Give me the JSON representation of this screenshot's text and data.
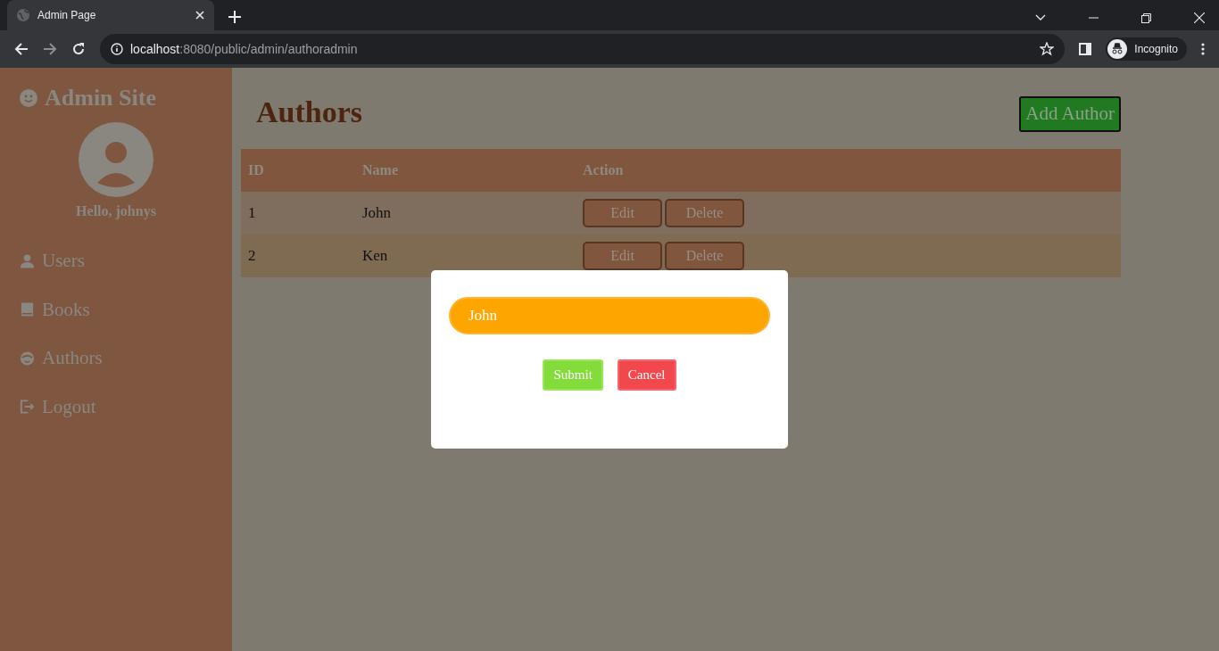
{
  "browser": {
    "tab_title": "Admin Page",
    "url_host": "localhost",
    "url_rest": ":8080/public/admin/authoradmin",
    "profile_label": "Incognito"
  },
  "sidebar": {
    "brand": "Admin Site",
    "greeting": "Hello, johnys",
    "items": [
      {
        "label": "Users"
      },
      {
        "label": "Books"
      },
      {
        "label": "Authors"
      },
      {
        "label": "Logout"
      }
    ]
  },
  "main": {
    "title": "Authors",
    "add_button": "Add Author",
    "table": {
      "columns": [
        "ID",
        "Name",
        "Action"
      ],
      "rows": [
        {
          "id": "1",
          "name": "John",
          "actions": [
            "Edit",
            "Delete"
          ]
        },
        {
          "id": "2",
          "name": "Ken",
          "actions": [
            "Edit",
            "Delete"
          ]
        }
      ]
    }
  },
  "modal": {
    "value": "John",
    "buttons": [
      {
        "label": "Submit",
        "kind": "submit"
      },
      {
        "label": "Cancel",
        "kind": "cancel"
      }
    ]
  }
}
